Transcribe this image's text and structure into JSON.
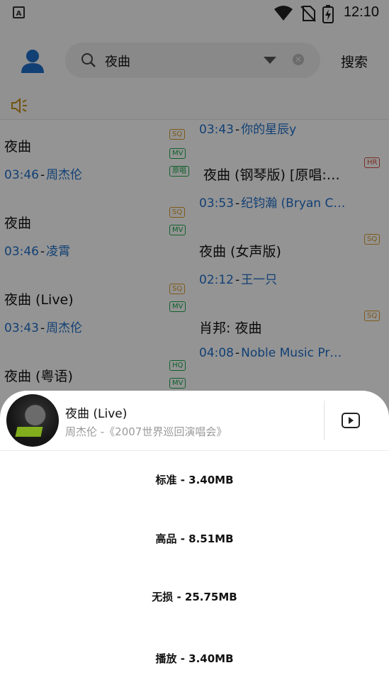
{
  "status_bar": {
    "time": "12:10",
    "app_icon_letter": "A"
  },
  "search": {
    "query": "夜曲",
    "button_label": "搜索"
  },
  "results_left": [
    {
      "title": "夜曲",
      "duration": "03:46",
      "artist": "周杰伦",
      "tags": [
        "SQ",
        "MV",
        "原唱"
      ]
    },
    {
      "title": "夜曲",
      "duration": "03:46",
      "artist": "凌霄",
      "tags": [
        "SQ",
        "MV"
      ]
    },
    {
      "title": "夜曲 (Live)",
      "duration": "03:43",
      "artist": "周杰伦",
      "tags": [
        "SQ",
        "MV"
      ]
    },
    {
      "title": "夜曲 (粤语)",
      "tags": [
        "HQ",
        "MV"
      ]
    }
  ],
  "results_right": [
    {
      "duration": "03:43",
      "artist": "你的星辰y"
    },
    {
      "title": "夜曲 (钢琴版) [原唱:…",
      "duration": "03:53",
      "artist": "纪钧瀚 (Bryan C…",
      "tags": [
        "HR"
      ]
    },
    {
      "title": "夜曲 (女声版)",
      "duration": "02:12",
      "artist": "王一只",
      "tags": [
        "SQ"
      ]
    },
    {
      "title": "肖邦: 夜曲",
      "duration": "04:08",
      "artist": "Noble Music Pr…",
      "tags": [
        "SQ"
      ]
    }
  ],
  "sheet": {
    "song_title": "夜曲 (Live)",
    "song_subtitle": "周杰伦 -《2007世界巡回演唱会》",
    "options": [
      {
        "label": "标准 - 3.40MB"
      },
      {
        "label": "高品 - 8.51MB"
      },
      {
        "label": "无损 - 25.75MB"
      },
      {
        "label": "播放 - 3.40MB"
      }
    ]
  },
  "colors": {
    "accent_blue": "#1f6fc9",
    "sq_tag": "#d99a2b",
    "mv_tag": "#1aa84b",
    "hr_tag": "#d24a3c"
  }
}
